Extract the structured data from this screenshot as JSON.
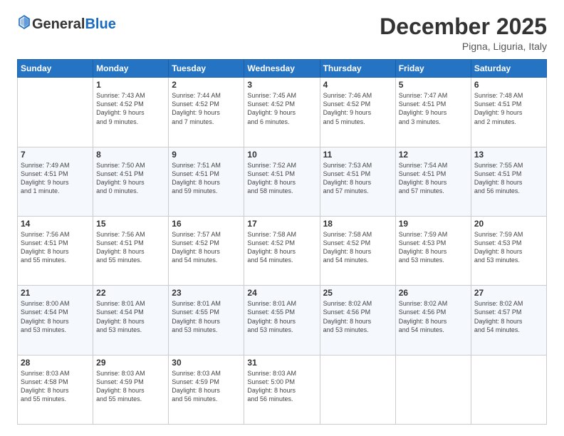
{
  "header": {
    "logo": {
      "general": "General",
      "blue": "Blue"
    },
    "title": "December 2025",
    "location": "Pigna, Liguria, Italy"
  },
  "calendar": {
    "columns": [
      "Sunday",
      "Monday",
      "Tuesday",
      "Wednesday",
      "Thursday",
      "Friday",
      "Saturday"
    ],
    "weeks": [
      [
        {
          "day": "",
          "info": ""
        },
        {
          "day": "1",
          "info": "Sunrise: 7:43 AM\nSunset: 4:52 PM\nDaylight: 9 hours\nand 9 minutes."
        },
        {
          "day": "2",
          "info": "Sunrise: 7:44 AM\nSunset: 4:52 PM\nDaylight: 9 hours\nand 7 minutes."
        },
        {
          "day": "3",
          "info": "Sunrise: 7:45 AM\nSunset: 4:52 PM\nDaylight: 9 hours\nand 6 minutes."
        },
        {
          "day": "4",
          "info": "Sunrise: 7:46 AM\nSunset: 4:52 PM\nDaylight: 9 hours\nand 5 minutes."
        },
        {
          "day": "5",
          "info": "Sunrise: 7:47 AM\nSunset: 4:51 PM\nDaylight: 9 hours\nand 3 minutes."
        },
        {
          "day": "6",
          "info": "Sunrise: 7:48 AM\nSunset: 4:51 PM\nDaylight: 9 hours\nand 2 minutes."
        }
      ],
      [
        {
          "day": "7",
          "info": "Sunrise: 7:49 AM\nSunset: 4:51 PM\nDaylight: 9 hours\nand 1 minute."
        },
        {
          "day": "8",
          "info": "Sunrise: 7:50 AM\nSunset: 4:51 PM\nDaylight: 9 hours\nand 0 minutes."
        },
        {
          "day": "9",
          "info": "Sunrise: 7:51 AM\nSunset: 4:51 PM\nDaylight: 8 hours\nand 59 minutes."
        },
        {
          "day": "10",
          "info": "Sunrise: 7:52 AM\nSunset: 4:51 PM\nDaylight: 8 hours\nand 58 minutes."
        },
        {
          "day": "11",
          "info": "Sunrise: 7:53 AM\nSunset: 4:51 PM\nDaylight: 8 hours\nand 57 minutes."
        },
        {
          "day": "12",
          "info": "Sunrise: 7:54 AM\nSunset: 4:51 PM\nDaylight: 8 hours\nand 57 minutes."
        },
        {
          "day": "13",
          "info": "Sunrise: 7:55 AM\nSunset: 4:51 PM\nDaylight: 8 hours\nand 56 minutes."
        }
      ],
      [
        {
          "day": "14",
          "info": "Sunrise: 7:56 AM\nSunset: 4:51 PM\nDaylight: 8 hours\nand 55 minutes."
        },
        {
          "day": "15",
          "info": "Sunrise: 7:56 AM\nSunset: 4:51 PM\nDaylight: 8 hours\nand 55 minutes."
        },
        {
          "day": "16",
          "info": "Sunrise: 7:57 AM\nSunset: 4:52 PM\nDaylight: 8 hours\nand 54 minutes."
        },
        {
          "day": "17",
          "info": "Sunrise: 7:58 AM\nSunset: 4:52 PM\nDaylight: 8 hours\nand 54 minutes."
        },
        {
          "day": "18",
          "info": "Sunrise: 7:58 AM\nSunset: 4:52 PM\nDaylight: 8 hours\nand 54 minutes."
        },
        {
          "day": "19",
          "info": "Sunrise: 7:59 AM\nSunset: 4:53 PM\nDaylight: 8 hours\nand 53 minutes."
        },
        {
          "day": "20",
          "info": "Sunrise: 7:59 AM\nSunset: 4:53 PM\nDaylight: 8 hours\nand 53 minutes."
        }
      ],
      [
        {
          "day": "21",
          "info": "Sunrise: 8:00 AM\nSunset: 4:54 PM\nDaylight: 8 hours\nand 53 minutes."
        },
        {
          "day": "22",
          "info": "Sunrise: 8:01 AM\nSunset: 4:54 PM\nDaylight: 8 hours\nand 53 minutes."
        },
        {
          "day": "23",
          "info": "Sunrise: 8:01 AM\nSunset: 4:55 PM\nDaylight: 8 hours\nand 53 minutes."
        },
        {
          "day": "24",
          "info": "Sunrise: 8:01 AM\nSunset: 4:55 PM\nDaylight: 8 hours\nand 53 minutes."
        },
        {
          "day": "25",
          "info": "Sunrise: 8:02 AM\nSunset: 4:56 PM\nDaylight: 8 hours\nand 53 minutes."
        },
        {
          "day": "26",
          "info": "Sunrise: 8:02 AM\nSunset: 4:56 PM\nDaylight: 8 hours\nand 54 minutes."
        },
        {
          "day": "27",
          "info": "Sunrise: 8:02 AM\nSunset: 4:57 PM\nDaylight: 8 hours\nand 54 minutes."
        }
      ],
      [
        {
          "day": "28",
          "info": "Sunrise: 8:03 AM\nSunset: 4:58 PM\nDaylight: 8 hours\nand 55 minutes."
        },
        {
          "day": "29",
          "info": "Sunrise: 8:03 AM\nSunset: 4:59 PM\nDaylight: 8 hours\nand 55 minutes."
        },
        {
          "day": "30",
          "info": "Sunrise: 8:03 AM\nSunset: 4:59 PM\nDaylight: 8 hours\nand 56 minutes."
        },
        {
          "day": "31",
          "info": "Sunrise: 8:03 AM\nSunset: 5:00 PM\nDaylight: 8 hours\nand 56 minutes."
        },
        {
          "day": "",
          "info": ""
        },
        {
          "day": "",
          "info": ""
        },
        {
          "day": "",
          "info": ""
        }
      ]
    ]
  }
}
